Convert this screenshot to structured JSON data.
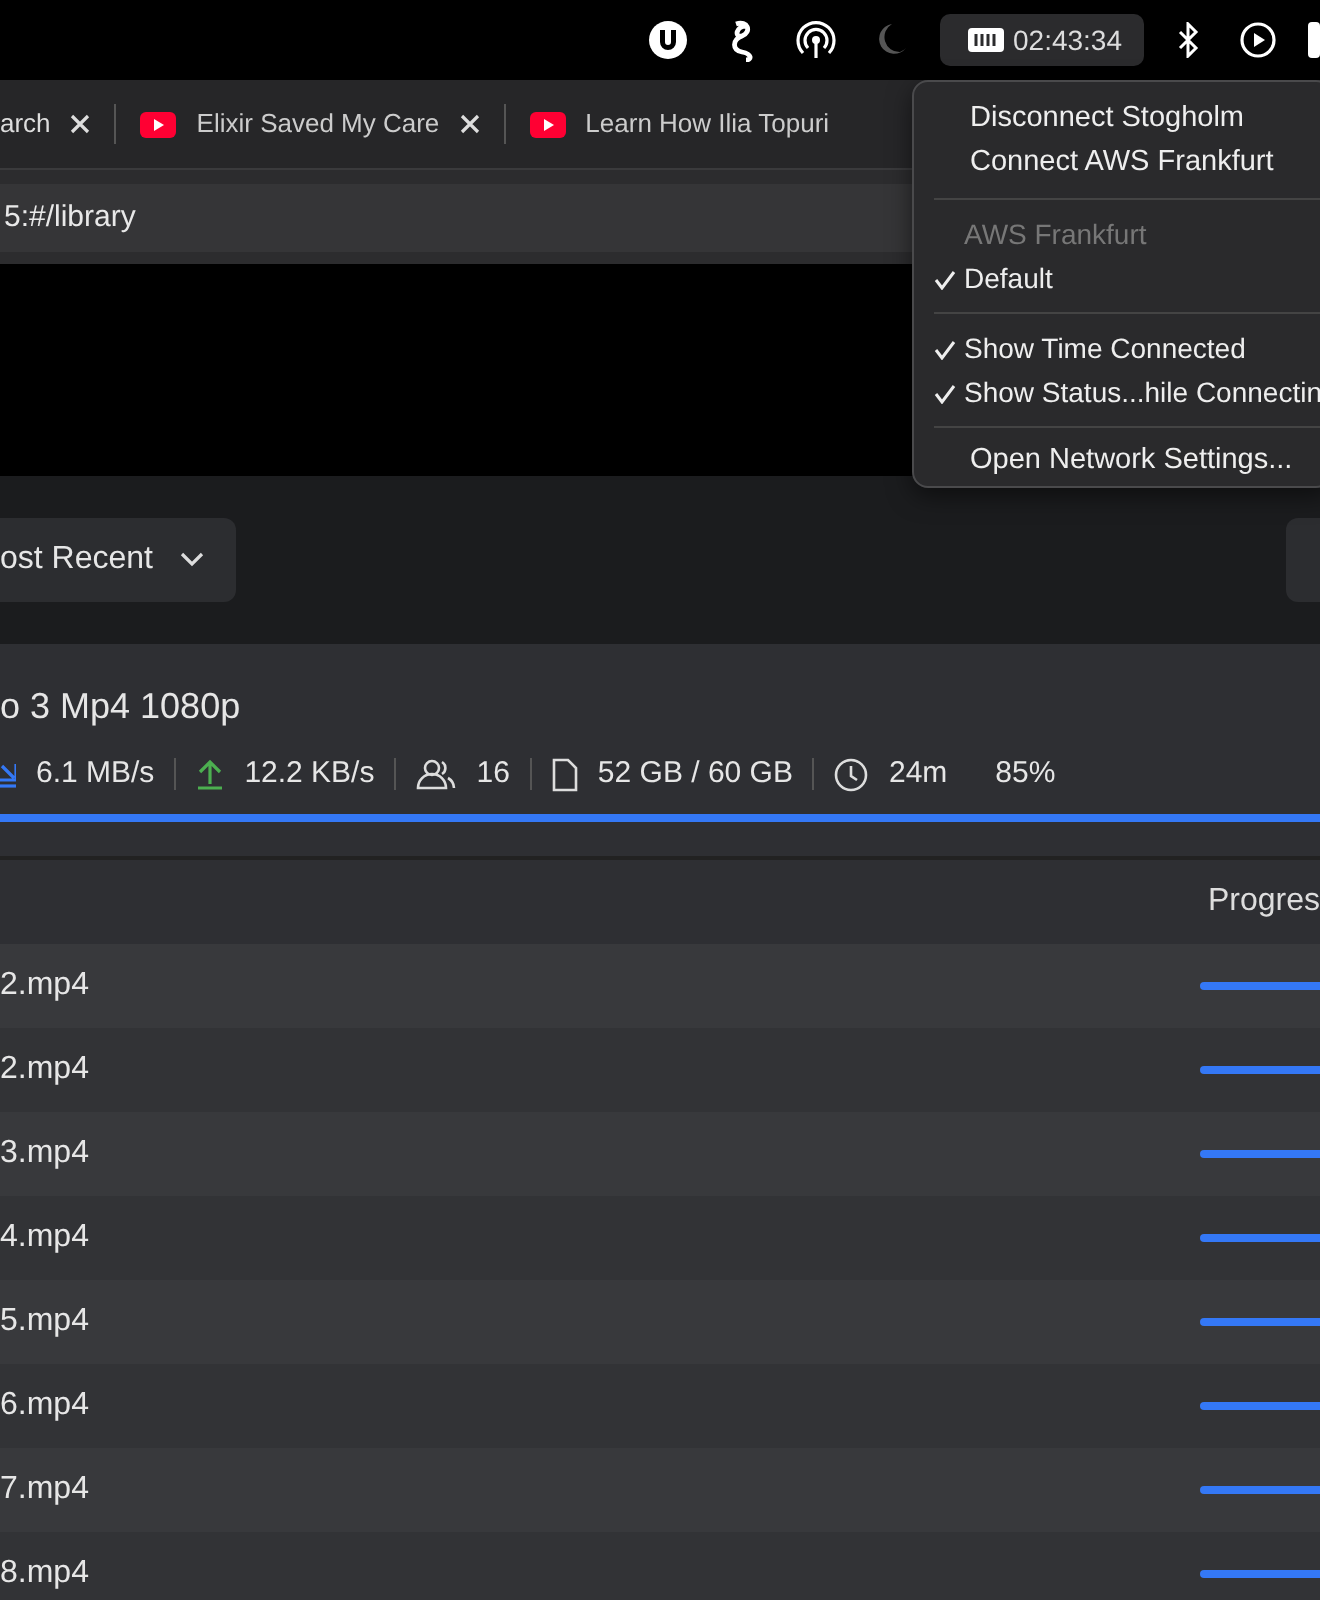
{
  "menu_bar": {
    "clock": "02:43:34"
  },
  "tabs": [
    {
      "title": "arch",
      "selected": false
    },
    {
      "title": "Elixir Saved My Care",
      "selected": false
    },
    {
      "title": "Learn How Ilia Topuri",
      "selected": false
    }
  ],
  "address_bar": {
    "url": "5:#/library"
  },
  "vpn_menu": {
    "items": [
      {
        "kind": "action",
        "label": "Disconnect Stogholm"
      },
      {
        "kind": "action",
        "label": "Connect AWS Frankfurt"
      },
      {
        "kind": "separator"
      },
      {
        "kind": "header",
        "label": "AWS Frankfurt"
      },
      {
        "kind": "check",
        "label": "Default",
        "checked": true
      },
      {
        "kind": "separator"
      },
      {
        "kind": "check",
        "label": "Show Time Connected",
        "checked": true
      },
      {
        "kind": "check",
        "label": "Show Status...hile Connectin",
        "checked": true
      },
      {
        "kind": "separator"
      },
      {
        "kind": "action",
        "label": "Open Network Settings..."
      }
    ]
  },
  "sort_dropdown": {
    "label": "ost Recent"
  },
  "torrent": {
    "title": "o 3 Mp4 1080p",
    "download_speed": "6.1 MB/s",
    "upload_speed": "12.2 KB/s",
    "peers": "16",
    "size": "52 GB / 60 GB",
    "eta": "24m",
    "percent": "85%",
    "level": 1
  },
  "files_table": {
    "columns": [
      "Progres"
    ],
    "rows": [
      {
        "name": "2.mp4",
        "level": 1
      },
      {
        "name": "2.mp4",
        "level": 1
      },
      {
        "name": "3.mp4",
        "level": 1
      },
      {
        "name": "4.mp4",
        "level": 1
      },
      {
        "name": "5.mp4",
        "level": 1
      },
      {
        "name": "6.mp4",
        "level": 1
      },
      {
        "name": "7.mp4",
        "level": 1
      },
      {
        "name": "8.mp4",
        "level": 1
      }
    ]
  }
}
